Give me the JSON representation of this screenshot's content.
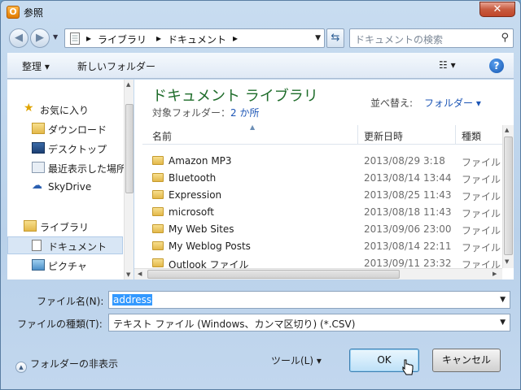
{
  "window": {
    "title": "参照",
    "app_icon": "O",
    "close": "✕"
  },
  "nav": {
    "breadcrumbs": [
      "ライブラリ",
      "ドキュメント"
    ],
    "search_placeholder": "ドキュメントの検索"
  },
  "toolbar": {
    "organize": "整理 ▾",
    "new_folder": "新しいフォルダー",
    "view": "☷ ▾",
    "help": "?"
  },
  "sidebar": {
    "items": [
      {
        "label": "お気に入り",
        "icon": "star-icon"
      },
      {
        "label": "ダウンロード",
        "icon": "download-folder-icon"
      },
      {
        "label": "デスクトップ",
        "icon": "desktop-icon"
      },
      {
        "label": "最近表示した場所",
        "icon": "recent-places-icon"
      },
      {
        "label": "SkyDrive",
        "icon": "skydrive-icon"
      },
      {
        "label": "ライブラリ",
        "icon": "library-icon"
      },
      {
        "label": "ドキュメント",
        "icon": "documents-icon",
        "selected": true
      },
      {
        "label": "ピクチャ",
        "icon": "pictures-icon"
      }
    ]
  },
  "library": {
    "title": "ドキュメント ライブラリ",
    "subtitle_prefix": "対象フォルダー：",
    "subtitle_link": "2 か所",
    "sort_label": "並べ替え:",
    "sort_value": "フォルダー ▾"
  },
  "columns": {
    "name": "名前",
    "date": "更新日時",
    "type": "種類"
  },
  "files": [
    {
      "name": "Amazon MP3",
      "date": "2013/08/29 3:18",
      "type": "ファイル"
    },
    {
      "name": "Bluetooth",
      "date": "2013/08/14 13:44",
      "type": "ファイル"
    },
    {
      "name": "Expression",
      "date": "2013/08/25 11:43",
      "type": "ファイル"
    },
    {
      "name": "microsoft",
      "date": "2013/08/18 11:43",
      "type": "ファイル"
    },
    {
      "name": "My Web Sites",
      "date": "2013/09/06 23:00",
      "type": "ファイル"
    },
    {
      "name": "My Weblog Posts",
      "date": "2013/08/14 22:11",
      "type": "ファイル"
    },
    {
      "name": "Outlook ファイル",
      "date": "2013/09/11 23:32",
      "type": "ファイル"
    }
  ],
  "form": {
    "filename_label": "ファイル名(N):",
    "filename_value": "address",
    "filetype_label": "ファイルの種類(T):",
    "filetype_value": "テキスト ファイル (Windows、カンマ区切り) (*.CSV)"
  },
  "footer": {
    "hide_folders": "フォルダーの非表示",
    "tools": "ツール(L)   ▾",
    "ok": "OK",
    "cancel": "キャンセル"
  }
}
